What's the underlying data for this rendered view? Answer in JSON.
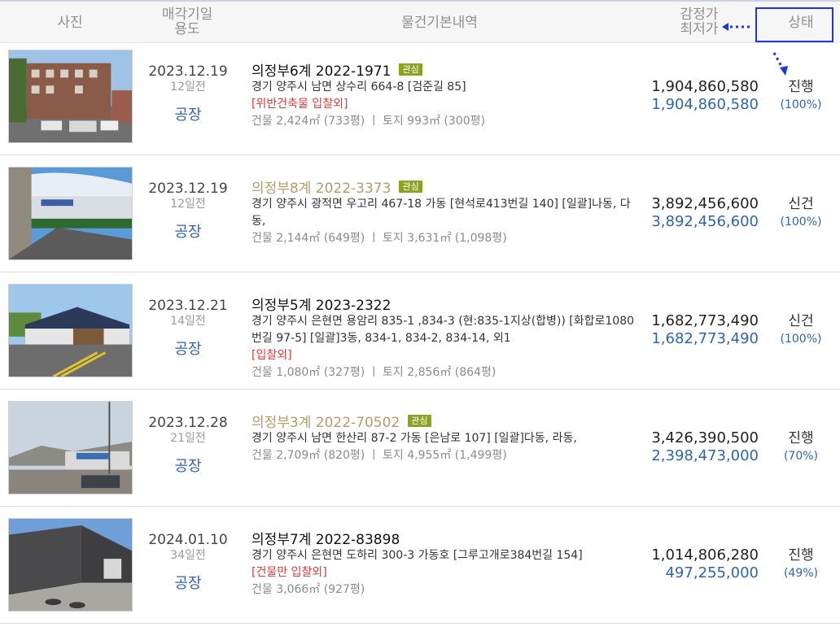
{
  "header": {
    "photo": "사진",
    "date_line1": "매각기일",
    "date_line2": "용도",
    "info": "물건기본내역",
    "price_line1": "감정가",
    "price_line2": "최저가",
    "status": "상태"
  },
  "items": [
    {
      "date": "2023.12.19",
      "dday": "12일전",
      "usage": "공장",
      "case": "의정부6계 2022-1971",
      "case_highlight": false,
      "interest": "관심",
      "address": "경기 양주시 남면 상수리 664-8 [검준길 85]",
      "tags": "[위반건축물   입찰외]",
      "area": "건물 2,424㎡ (733평)   ㅣ   토지 993㎡ (300평)",
      "appraisal": "1,904,860,580",
      "minimum": "1,904,860,580",
      "status": "진행",
      "rate": "(100%)"
    },
    {
      "date": "2023.12.19",
      "dday": "12일전",
      "usage": "공장",
      "case": "의정부8계 2022-3373",
      "case_highlight": true,
      "interest": "관심",
      "address": "경기 양주시 광적면 우고리 467-18 가동 [현석로413번길 140] [일괄]나동, 다동,",
      "tags": "",
      "area": "건물 2,144㎡ (649평)   ㅣ   토지 3,631㎡ (1,098평)",
      "appraisal": "3,892,456,600",
      "minimum": "3,892,456,600",
      "status": "신건",
      "rate": "(100%)"
    },
    {
      "date": "2023.12.21",
      "dday": "14일전",
      "usage": "공장",
      "case": "의정부5계 2023-2322",
      "case_highlight": false,
      "interest": "",
      "address": "경기 양주시 은현면 용암리 835-1 ,834-3 (현:835-1지상(합병)) [화합로1080번길 97-5] [일괄]3동, 834-1, 834-2, 834-14, 외1",
      "tags": "[입찰외]",
      "area": "건물 1,080㎡ (327평)   ㅣ   토지 2,856㎡ (864평)",
      "appraisal": "1,682,773,490",
      "minimum": "1,682,773,490",
      "status": "신건",
      "rate": "(100%)"
    },
    {
      "date": "2023.12.28",
      "dday": "21일전",
      "usage": "공장",
      "case": "의정부3계 2022-70502",
      "case_highlight": true,
      "interest": "관심",
      "address": "경기 양주시 남면 한산리 87-2 가동 [은남로 107] [일괄]다동, 라동,",
      "tags": "",
      "area": "건물 2,709㎡ (820평)   ㅣ   토지 4,955㎡ (1,499평)",
      "appraisal": "3,426,390,500",
      "minimum": "2,398,473,000",
      "status": "진행",
      "rate": "(70%)"
    },
    {
      "date": "2024.01.10",
      "dday": "34일전",
      "usage": "공장",
      "case": "의정부7계 2022-83898",
      "case_highlight": false,
      "interest": "",
      "address": "경기 양주시 은현면 도하리 300-3 가동호 [그루고개로384번길 154]",
      "tags": "[건물만   입찰외]",
      "area": "건물 3,066㎡ (927평)",
      "appraisal": "1,014,806,280",
      "minimum": "497,255,000",
      "status": "진행",
      "rate": "(49%)"
    }
  ]
}
